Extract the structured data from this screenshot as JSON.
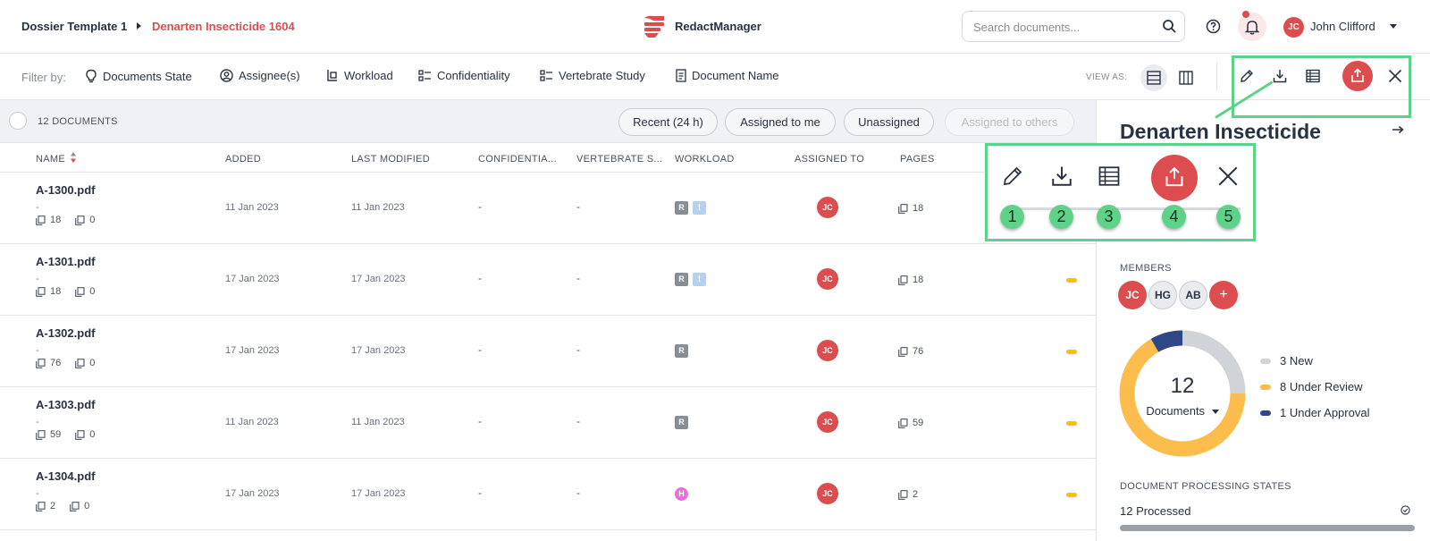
{
  "header": {
    "breadcrumb_template": "Dossier Template 1",
    "breadcrumb_dossier": "Denarten Insecticide 1604",
    "app_name": "RedactManager",
    "search_placeholder": "Search documents...",
    "user_initials": "JC",
    "user_name": "John Clifford",
    "accent_color": "#dd4d50"
  },
  "filters": {
    "label": "Filter by:",
    "items": [
      {
        "label": "Documents State",
        "icon": "lightbulb-icon"
      },
      {
        "label": "Assignee(s)",
        "icon": "user-circle-icon"
      },
      {
        "label": "Workload",
        "icon": "workload-icon"
      },
      {
        "label": "Confidentiality",
        "icon": "list-check-icon"
      },
      {
        "label": "Vertebrate Study",
        "icon": "list-check-icon"
      },
      {
        "label": "Document Name",
        "icon": "document-icon"
      }
    ],
    "view_as": "VIEW AS:"
  },
  "list": {
    "count_label": "12 DOCUMENTS",
    "quick_filters": [
      "Recent (24 h)",
      "Assigned to me",
      "Unassigned",
      "Assigned to others"
    ],
    "columns": [
      "NAME",
      "ADDED",
      "LAST MODIFIED",
      "CONFIDENTIA...",
      "VERTEBRATE S...",
      "WORKLOAD",
      "ASSIGNED TO",
      "PAGES"
    ],
    "rows": [
      {
        "name": "A-1300.pdf",
        "dash": "-",
        "pages": "18",
        "annotations": "0",
        "added": "11 Jan 2023",
        "modified": "11 Jan 2023",
        "confidentiality": "-",
        "vertebrate": "-",
        "workload": [
          "R",
          "I"
        ],
        "assignee": "JC",
        "page_count": "18"
      },
      {
        "name": "A-1301.pdf",
        "dash": "-",
        "pages": "18",
        "annotations": "0",
        "added": "17 Jan 2023",
        "modified": "17 Jan 2023",
        "confidentiality": "-",
        "vertebrate": "-",
        "workload": [
          "R",
          "I"
        ],
        "assignee": "JC",
        "page_count": "18"
      },
      {
        "name": "A-1302.pdf",
        "dash": "-",
        "pages": "76",
        "annotations": "0",
        "added": "17 Jan 2023",
        "modified": "17 Jan 2023",
        "confidentiality": "-",
        "vertebrate": "-",
        "workload": [
          "R"
        ],
        "assignee": "JC",
        "page_count": "76"
      },
      {
        "name": "A-1303.pdf",
        "dash": "-",
        "pages": "59",
        "annotations": "0",
        "added": "11 Jan 2023",
        "modified": "11 Jan 2023",
        "confidentiality": "-",
        "vertebrate": "-",
        "workload": [
          "R"
        ],
        "assignee": "JC",
        "page_count": "59"
      },
      {
        "name": "A-1304.pdf",
        "dash": "-",
        "pages": "2",
        "annotations": "0",
        "added": "17 Jan 2023",
        "modified": "17 Jan 2023",
        "confidentiality": "-",
        "vertebrate": "-",
        "workload": [
          "H"
        ],
        "assignee": "JC",
        "page_count": "2"
      }
    ]
  },
  "panel": {
    "title": "Denarten Insecticide",
    "members_label": "MEMBERS",
    "members": [
      "JC",
      "HG",
      "AB",
      "+"
    ],
    "chart_total": "12",
    "chart_label": "Documents",
    "legend": [
      {
        "label": "3 New",
        "color": "#d0d3d8"
      },
      {
        "label": "8 Under Review",
        "color": "#fdbd4d"
      },
      {
        "label": "1 Under Approval",
        "color": "#2f4785"
      }
    ],
    "processing_label": "DOCUMENT PROCESSING STATES",
    "processing_value": "12 Processed"
  },
  "callout": {
    "numbers": [
      "1",
      "2",
      "3",
      "4",
      "5"
    ],
    "icons": [
      "edit-icon",
      "download-icon",
      "table-icon",
      "upload-icon",
      "close-icon"
    ]
  }
}
